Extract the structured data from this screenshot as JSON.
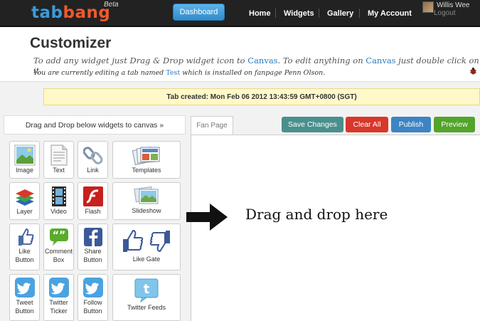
{
  "header": {
    "logo_tab": "tab",
    "logo_bang": "bang",
    "beta": "Beta",
    "dashboard": "Dashboard",
    "nav": [
      "Home",
      "Widgets",
      "Gallery",
      "My Account"
    ],
    "user_name": "Willis Wee",
    "logout": "Logout"
  },
  "page": {
    "title": "Customizer",
    "desc1_a": "To add any widget just Drag & Drop widget icon to ",
    "desc1_link1": "Canvas",
    "desc1_b": ". To edit anything on ",
    "desc1_link2": "Canvas",
    "desc1_c": " just double click on it.",
    "desc2_a": "You are currently editing a tab named ",
    "desc2_link": "Test",
    "desc2_b": " which is installed on fanpage Penn Olson."
  },
  "notice": "Tab created: Mon Feb 06 2012 13:43:59 GMT+0800 (SGT)",
  "sidebar": {
    "drag_label": "Drag and Drop below widgets to canvas »",
    "widgets": [
      {
        "label": "Image",
        "icon": "image-icon"
      },
      {
        "label": "Text",
        "icon": "text-icon"
      },
      {
        "label": "Link",
        "icon": "link-icon"
      },
      {
        "label": "Templates",
        "icon": "templates-icon"
      },
      {
        "label": "Layer",
        "icon": "layer-icon"
      },
      {
        "label": "Video",
        "icon": "video-icon"
      },
      {
        "label": "Flash",
        "icon": "flash-icon"
      },
      {
        "label": "Slideshow",
        "icon": "slideshow-icon"
      },
      {
        "label": "Like Button",
        "icon": "like-icon"
      },
      {
        "label": "Comment Box",
        "icon": "comment-icon"
      },
      {
        "label": "Share Button",
        "icon": "share-icon"
      },
      {
        "label": "Like Gate",
        "icon": "like-gate-icon"
      },
      {
        "label": "Tweet Button",
        "icon": "tweet-icon"
      },
      {
        "label": "Twitter Ticker",
        "icon": "twitter-ticker-icon"
      },
      {
        "label": "Follow Button",
        "icon": "follow-icon"
      },
      {
        "label": "Twitter Feeds",
        "icon": "twitter-feeds-icon"
      }
    ]
  },
  "canvas": {
    "tab": "Fan Page",
    "save": "Save Changes",
    "clear": "Clear All",
    "publish": "Publish",
    "preview": "Preview",
    "drop_text": "Drag and drop here"
  },
  "colors": {
    "save": "#4a8f8d",
    "clear": "#d9372b",
    "publish": "#3d84c4",
    "preview": "#53a42b"
  }
}
